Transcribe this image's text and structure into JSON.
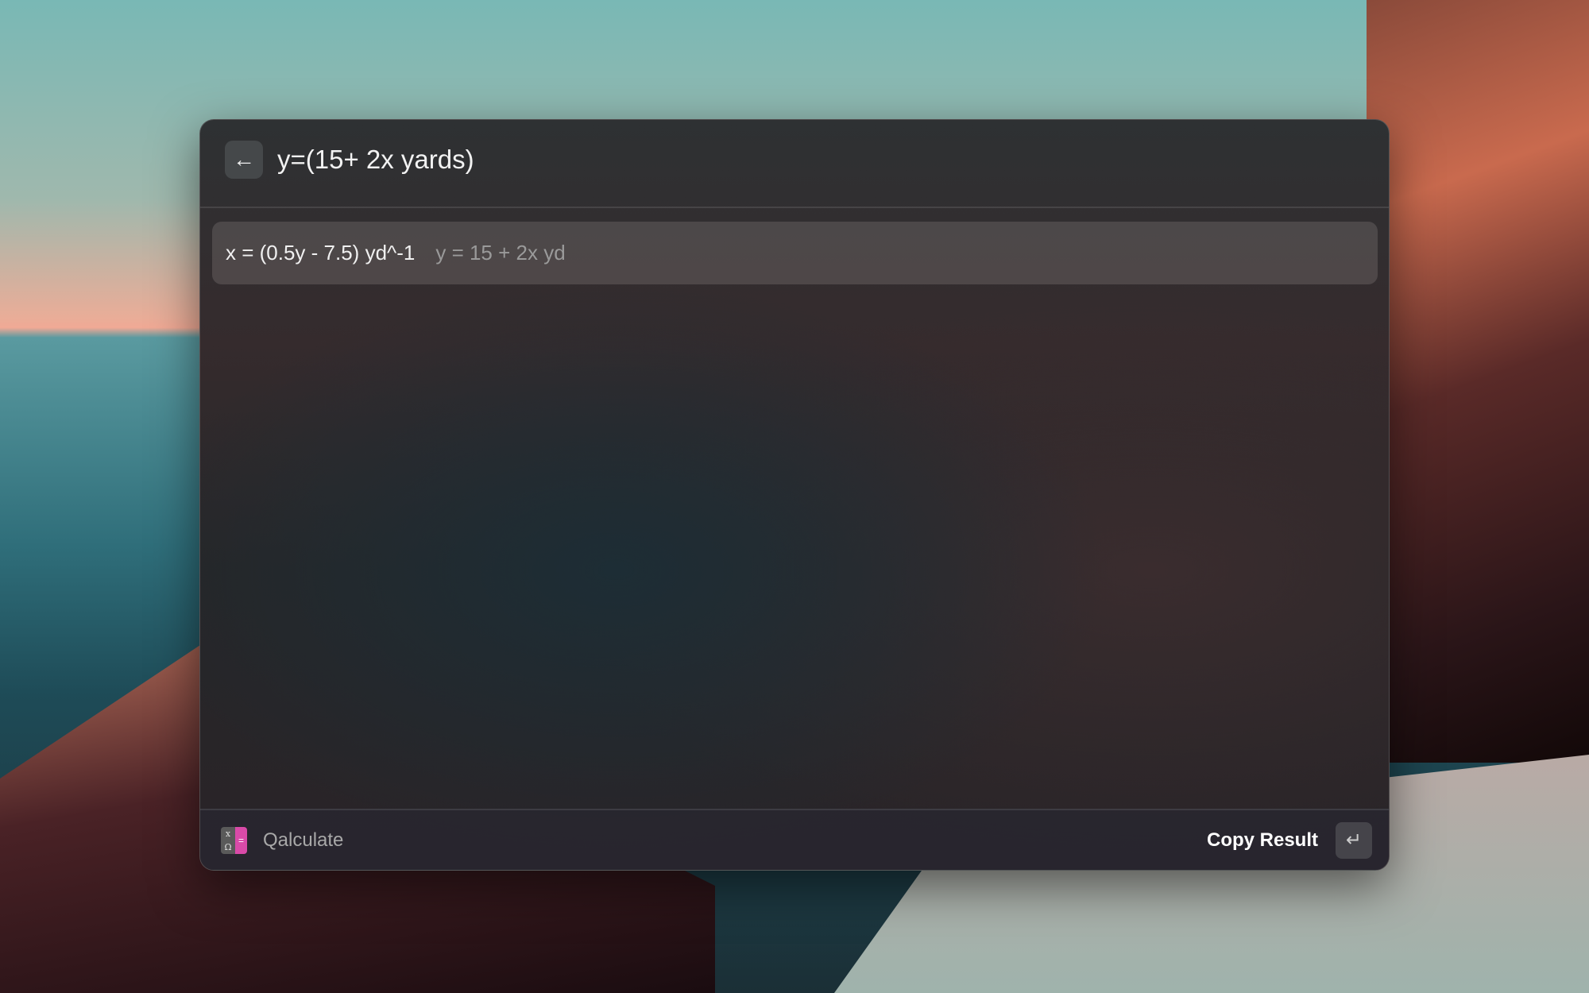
{
  "search": {
    "query": "y=(15+ 2x yards)",
    "back_icon": "arrow-left-icon"
  },
  "results": [
    {
      "main": "x = (0.5y - 7.5) yd^-1",
      "subtitle": "y = 15 + 2x yd"
    }
  ],
  "footer": {
    "app_name": "Qalculate",
    "app_icon_glyphs": {
      "top": "x",
      "bottom": "Ω",
      "right": "="
    },
    "action_label": "Copy Result",
    "action_key_icon": "return-key-icon",
    "accent": "#d94aa8"
  }
}
